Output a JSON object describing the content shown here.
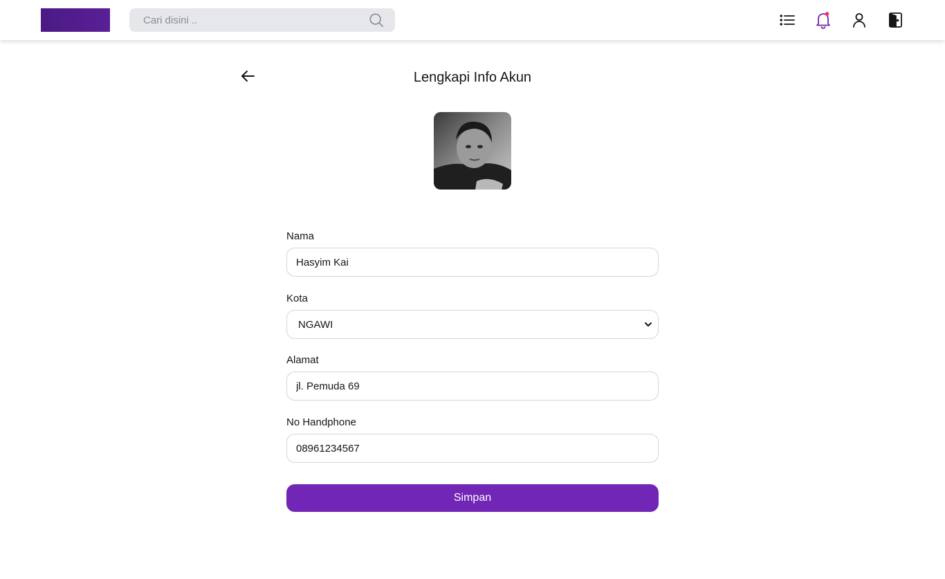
{
  "header": {
    "search_placeholder": "Cari disini ..",
    "icons": [
      "list-icon",
      "bell-icon",
      "user-icon",
      "logout-icon"
    ],
    "notification_dot_color": "#fa2c5a",
    "bell_color": "#7126b5",
    "logo_color": "#4b1a85"
  },
  "page": {
    "title": "Lengkapi Info Akun"
  },
  "form": {
    "name_label": "Nama",
    "name_value": "Hasyim Kai",
    "city_label": "Kota",
    "city_value": "NGAWI",
    "address_label": "Alamat",
    "address_value": "jl. Pemuda 69",
    "phone_label": "No Handphone",
    "phone_value": "08961234567",
    "submit_label": "Simpan"
  },
  "colors": {
    "accent": "#7126b5",
    "input_border": "#d5d5d9",
    "search_bg": "#e6e7eb"
  }
}
